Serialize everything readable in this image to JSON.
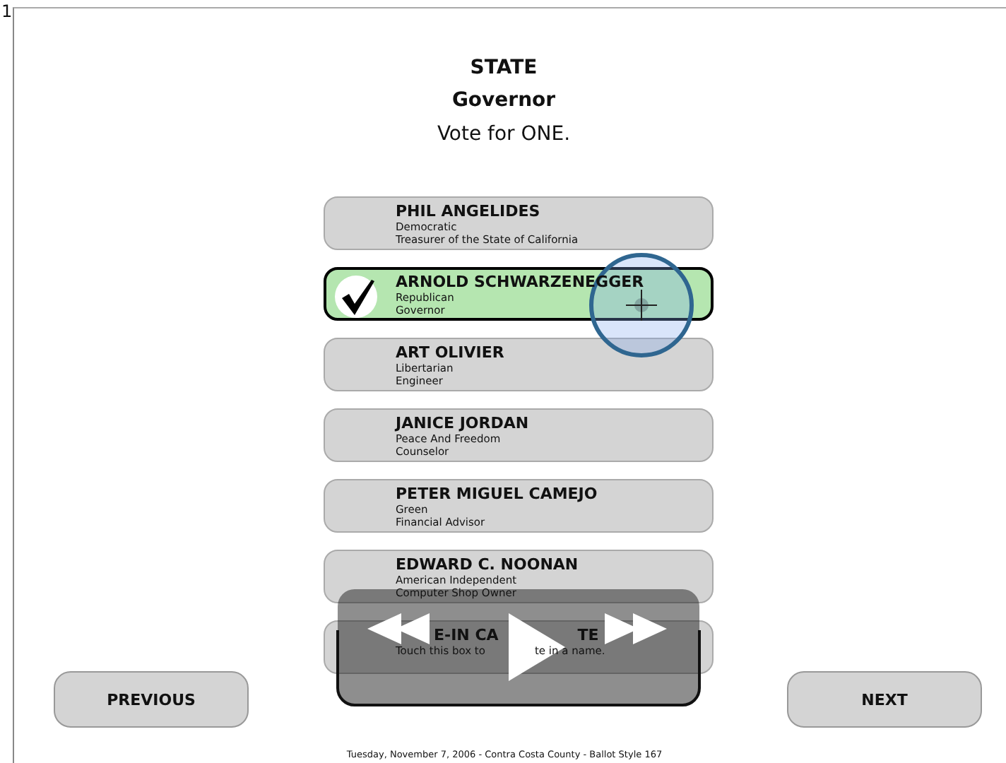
{
  "page_number": "1",
  "contest": {
    "section": "STATE",
    "office": "Governor",
    "instruction": "Vote for ONE."
  },
  "candidates": [
    {
      "kind": "candidate",
      "name": "PHIL ANGELIDES",
      "party": "Democratic",
      "occupation": "Treasurer of the State of California",
      "selected": false
    },
    {
      "kind": "candidate",
      "name": "ARNOLD SCHWARZENEGGER",
      "party": "Republican",
      "occupation": "Governor",
      "selected": true
    },
    {
      "kind": "candidate",
      "name": "ART OLIVIER",
      "party": "Libertarian",
      "occupation": "Engineer",
      "selected": false
    },
    {
      "kind": "candidate",
      "name": "JANICE JORDAN",
      "party": "Peace And Freedom",
      "occupation": "Counselor",
      "selected": false
    },
    {
      "kind": "candidate",
      "name": "PETER MIGUEL CAMEJO",
      "party": "Green",
      "occupation": "Financial Advisor",
      "selected": false
    },
    {
      "kind": "candidate",
      "name": "EDWARD C. NOONAN",
      "party": "American Independent",
      "occupation": "Computer Shop Owner",
      "selected": false
    },
    {
      "kind": "write_in",
      "title_parts": [
        "E-IN CA",
        "TE"
      ],
      "hint_parts": [
        "Touch this box to",
        "te in a name."
      ],
      "selected": false
    }
  ],
  "buttons": {
    "previous": "PREVIOUS",
    "next": "NEXT"
  },
  "footer": "Tuesday, November 7, 2006 - Contra Costa County - Ballot Style 167"
}
